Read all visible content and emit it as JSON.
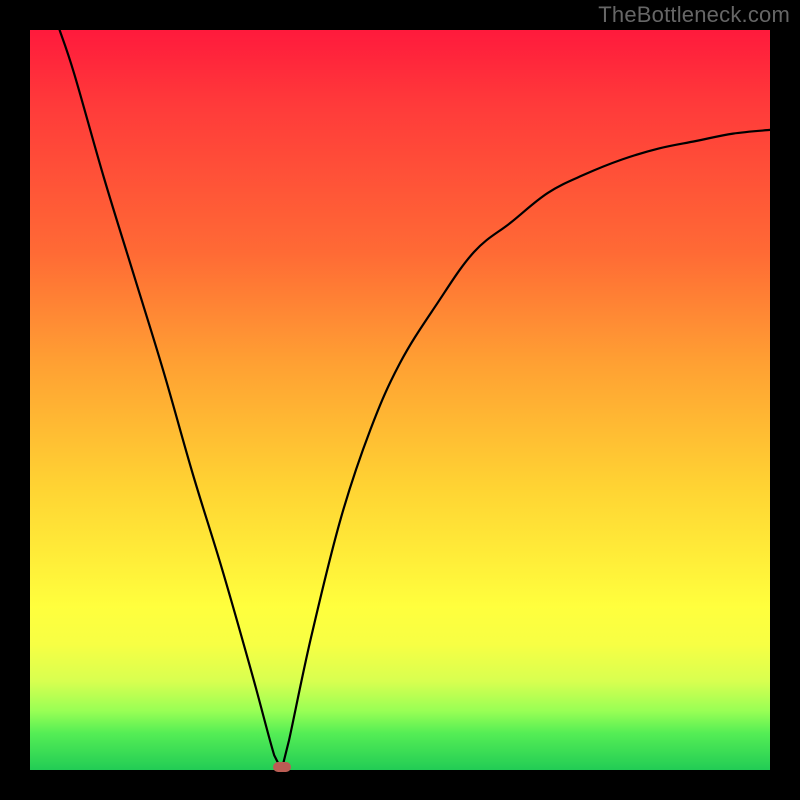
{
  "watermark": "TheBottleneck.com",
  "chart_data": {
    "type": "line",
    "title": "",
    "xlabel": "",
    "ylabel": "",
    "xlim": [
      0,
      100
    ],
    "ylim": [
      0,
      100
    ],
    "left_branch_start_x": 4,
    "min": {
      "x": 34,
      "y": 0
    },
    "series": [
      {
        "name": "curve",
        "x": [
          4,
          6,
          10,
          14,
          18,
          22,
          26,
          30,
          33,
          34,
          35,
          38,
          42,
          46,
          50,
          55,
          60,
          65,
          70,
          75,
          80,
          85,
          90,
          95,
          100
        ],
        "y": [
          100,
          94,
          80,
          67,
          54,
          40,
          27,
          13,
          2,
          0,
          4,
          18,
          34,
          46,
          55,
          63,
          70,
          74,
          78,
          80.5,
          82.5,
          84,
          85,
          86,
          86.5
        ]
      }
    ],
    "gradient_stops": [
      {
        "stop": 0,
        "color": "#ff1a3c"
      },
      {
        "stop": 30,
        "color": "#ff6a35"
      },
      {
        "stop": 62,
        "color": "#ffd433"
      },
      {
        "stop": 78,
        "color": "#ffff3d"
      },
      {
        "stop": 100,
        "color": "#22cc55"
      }
    ]
  }
}
